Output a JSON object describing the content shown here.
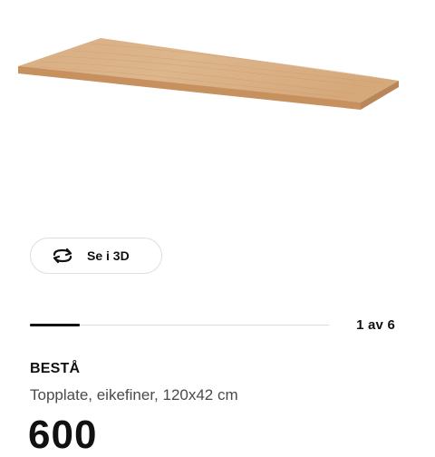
{
  "product": {
    "image_description_icon": "tabletop-image",
    "view_3d": {
      "label": "Se i 3D",
      "icon": "rotate-3d-icon"
    },
    "carousel": {
      "counter": "1 av 6",
      "current": 1,
      "total": 6
    },
    "name": "BESTÅ",
    "description": "Topplate, eikefiner, 120x42 cm",
    "price": "600"
  },
  "colors": {
    "wood_light": "#dcb58c",
    "wood_top": "#d4a77a",
    "wood_edge": "#b98659",
    "text_primary": "#111111",
    "text_secondary": "#4a4a4a",
    "track": "#dcdcdc"
  }
}
